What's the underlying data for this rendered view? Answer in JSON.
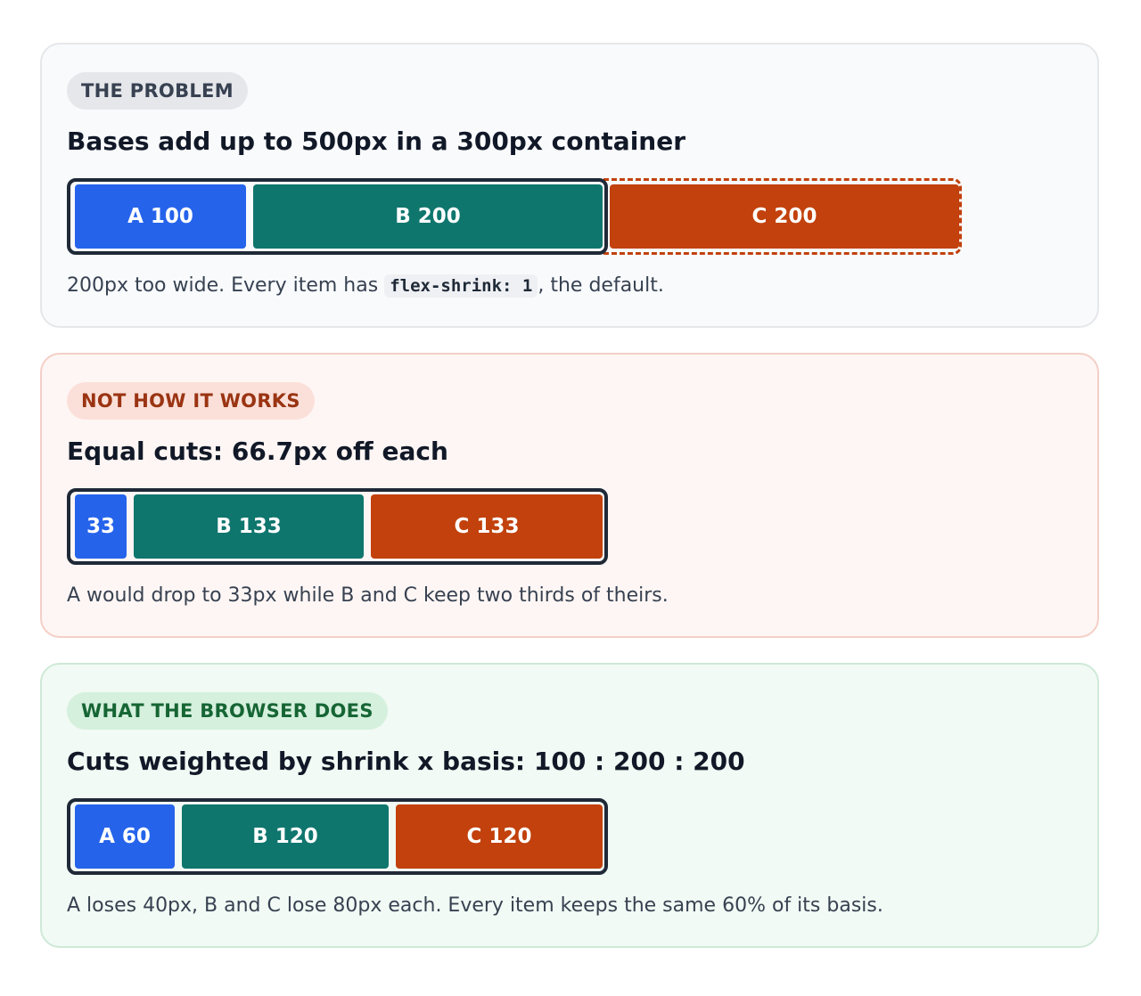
{
  "colors": {
    "item_a": "#2563eb",
    "item_b": "#0f766e",
    "item_c": "#c2410c",
    "track_border": "#1f2937",
    "overflow_dash": "#c2410c"
  },
  "panels": {
    "problem": {
      "badge": "THE PROBLEM",
      "title": "Bases add up to 500px in a 300px container",
      "items": {
        "a": "A 100",
        "b": "B 200",
        "c": "C 200"
      },
      "caption_before": "200px too wide. Every item has ",
      "caption_code": "flex-shrink: 1",
      "caption_after": ", the default."
    },
    "equal_cuts": {
      "badge": "NOT HOW IT WORKS",
      "title": "Equal cuts: 66.7px off each",
      "items": {
        "a": "33",
        "b": "B 133",
        "c": "C 133"
      },
      "caption": "A would drop to 33px while B and C keep two thirds of theirs."
    },
    "browser": {
      "badge": "WHAT THE BROWSER DOES",
      "title": "Cuts weighted by shrink x basis: 100 : 200 : 200",
      "items": {
        "a": "A 60",
        "b": "B 120",
        "c": "C 120"
      },
      "caption": "A loses 40px, B and C lose 80px each. Every item keeps the same 60% of its basis."
    }
  }
}
